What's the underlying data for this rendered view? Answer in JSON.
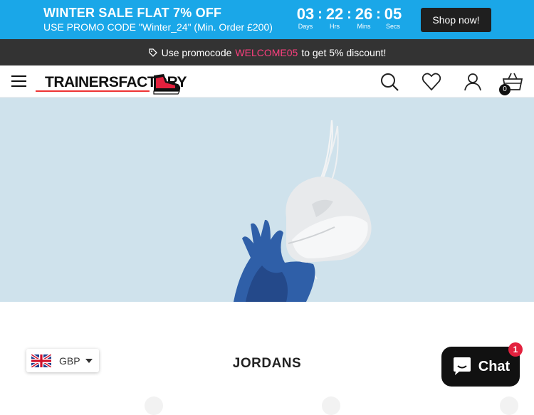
{
  "promo": {
    "title": "WINTER SALE FLAT 7% OFF",
    "subtitle": "USE PROMO CODE \"Winter_24\" (Min. Order £200)",
    "countdown": {
      "days": "03",
      "days_label": "Days",
      "hours": "22",
      "hours_label": "Hrs",
      "mins": "26",
      "mins_label": "Mins",
      "secs": "05",
      "secs_label": "Secs",
      "separator": ":"
    },
    "shop_button": "Shop now!",
    "bg_color": "#1aa7e8"
  },
  "notice": {
    "prefix": "Use promocode",
    "code": "WELCOME05",
    "suffix": "to get 5% discount!",
    "icon": "tag-icon"
  },
  "header": {
    "logo_text": "TRAINERSFACTORY",
    "icons": [
      "menu-icon",
      "search-icon",
      "heart-icon",
      "user-icon",
      "basket-icon"
    ],
    "cart_count": "0"
  },
  "section": {
    "title": "JORDANS"
  },
  "currency": {
    "code": "GBP",
    "flag": "uk-flag-icon"
  },
  "chat": {
    "label": "Chat",
    "badge": "1"
  }
}
